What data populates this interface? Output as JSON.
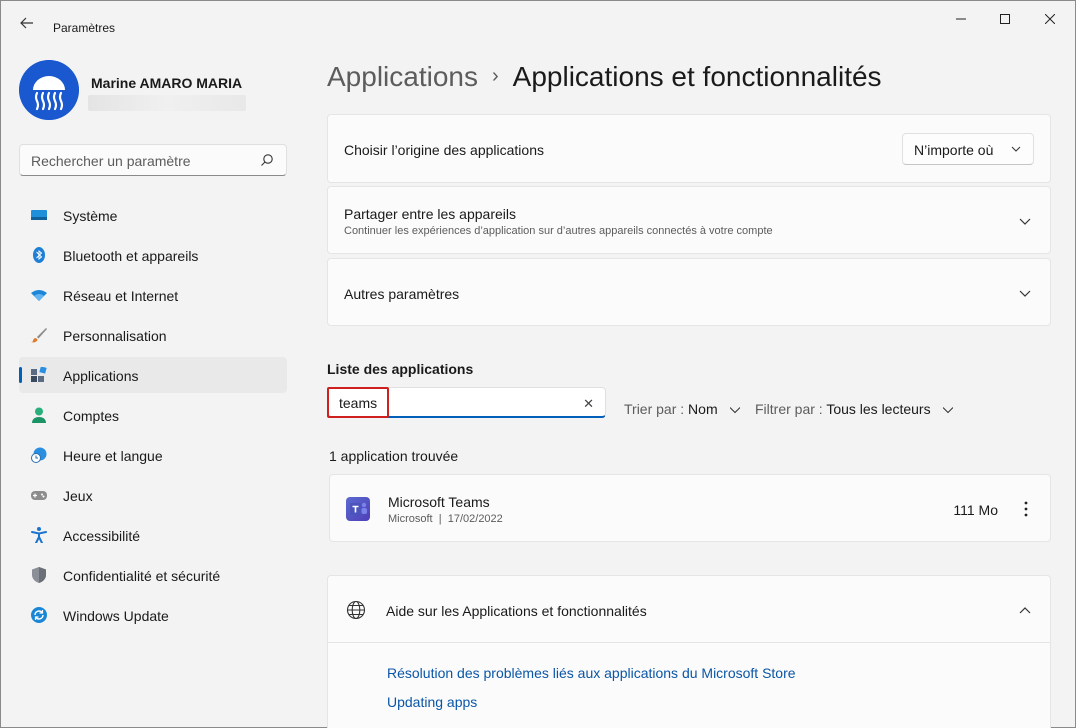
{
  "window": {
    "title": "Paramètres",
    "back_icon": "back-arrow-icon",
    "minimize_icon": "minimize-icon",
    "maximize_icon": "maximize-icon",
    "close_icon": "close-icon"
  },
  "profile": {
    "name": "Marine AMARO MARIA"
  },
  "search": {
    "placeholder": "Rechercher un paramètre"
  },
  "sidebar": {
    "items": [
      {
        "label": "Système",
        "icon": "system-icon",
        "selected": false
      },
      {
        "label": "Bluetooth et appareils",
        "icon": "bluetooth-icon",
        "selected": false
      },
      {
        "label": "Réseau et Internet",
        "icon": "wifi-icon",
        "selected": false
      },
      {
        "label": "Personnalisation",
        "icon": "brush-icon",
        "selected": false
      },
      {
        "label": "Applications",
        "icon": "apps-icon",
        "selected": true
      },
      {
        "label": "Comptes",
        "icon": "person-icon",
        "selected": false
      },
      {
        "label": "Heure et langue",
        "icon": "clock-globe-icon",
        "selected": false
      },
      {
        "label": "Jeux",
        "icon": "gamepad-icon",
        "selected": false
      },
      {
        "label": "Accessibilité",
        "icon": "accessibility-icon",
        "selected": false
      },
      {
        "label": "Confidentialité et sécurité",
        "icon": "shield-icon",
        "selected": false
      },
      {
        "label": "Windows Update",
        "icon": "update-icon",
        "selected": false
      }
    ]
  },
  "breadcrumb": {
    "parent": "Applications",
    "separator": "›",
    "current": "Applications et fonctionnalités"
  },
  "cards": {
    "origin": {
      "title": "Choisir l’origine des applications",
      "dropdown_value": "N’importe où"
    },
    "share": {
      "title": "Partager entre les appareils",
      "subtitle": "Continuer les expériences d’application sur d’autres appareils connectés à votre compte"
    },
    "other": {
      "title": "Autres paramètres"
    }
  },
  "app_list": {
    "label": "Liste des applications",
    "search_value": "teams",
    "sort_label": "Trier par :",
    "sort_value": "Nom",
    "filter_label": "Filtrer par :",
    "filter_value": "Tous les lecteurs",
    "found_text": "1 application trouvée",
    "apps": [
      {
        "name": "Microsoft Teams",
        "publisher": "Microsoft",
        "separator": "|",
        "date": "17/02/2022",
        "size": "111 Mo",
        "icon": "teams-icon"
      }
    ]
  },
  "help": {
    "title": "Aide sur les Applications et fonctionnalités",
    "links": [
      "Résolution des problèmes liés aux applications du Microsoft Store",
      "Updating apps"
    ]
  },
  "colors": {
    "accent": "#005fb8",
    "highlight": "#d01f1f",
    "link": "#0a56a6"
  }
}
